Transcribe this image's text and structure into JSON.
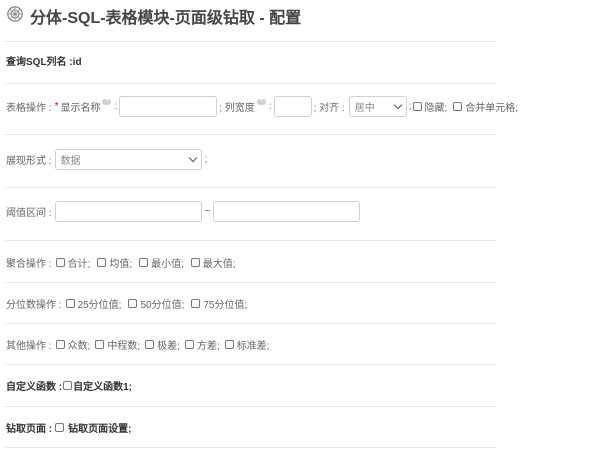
{
  "page": {
    "title": "分体-SQL-表格模块-页面级钻取 - 配置"
  },
  "query_sql": {
    "label": "查询SQL列名 :id"
  },
  "table_op": {
    "label": "表格操作 :",
    "required_mark": "*",
    "display_name_label": "显示名称",
    "display_name_value": "",
    "colon": ":",
    "col_width_label": "; 列宽度",
    "col_width_value": "",
    "align_label": "; 对齐 :",
    "align_value": "居中",
    "sep": ";",
    "hide_label": "隐藏;",
    "merge_label": "合并单元格;"
  },
  "display": {
    "label": "展现形式 :",
    "value": "数据",
    "suffix": ";"
  },
  "threshold": {
    "label": "阈值区间 :",
    "min_value": "",
    "tilde": "~",
    "max_value": ""
  },
  "aggregate": {
    "label": "聚合操作 :",
    "options": [
      "合计;",
      "均值;",
      "最小值;",
      "最大值;"
    ]
  },
  "quantile": {
    "label": "分位数操作 :",
    "options": [
      "25分位值;",
      "50分位值;",
      "75分位值;"
    ]
  },
  "other": {
    "label": "其他操作 :",
    "options": [
      "众数;",
      "中程数;",
      "极差;",
      "方差;",
      "标准差;"
    ]
  },
  "custom_func": {
    "label": "自定义函数 :",
    "option": "自定义函数1;"
  },
  "drill": {
    "label": "钻取页面 :",
    "option": "钻取页面设置;"
  },
  "icons": {
    "logo": "gear-logo-icon",
    "help": "question-help-icon",
    "dropdown": "chevron-down-icon"
  }
}
